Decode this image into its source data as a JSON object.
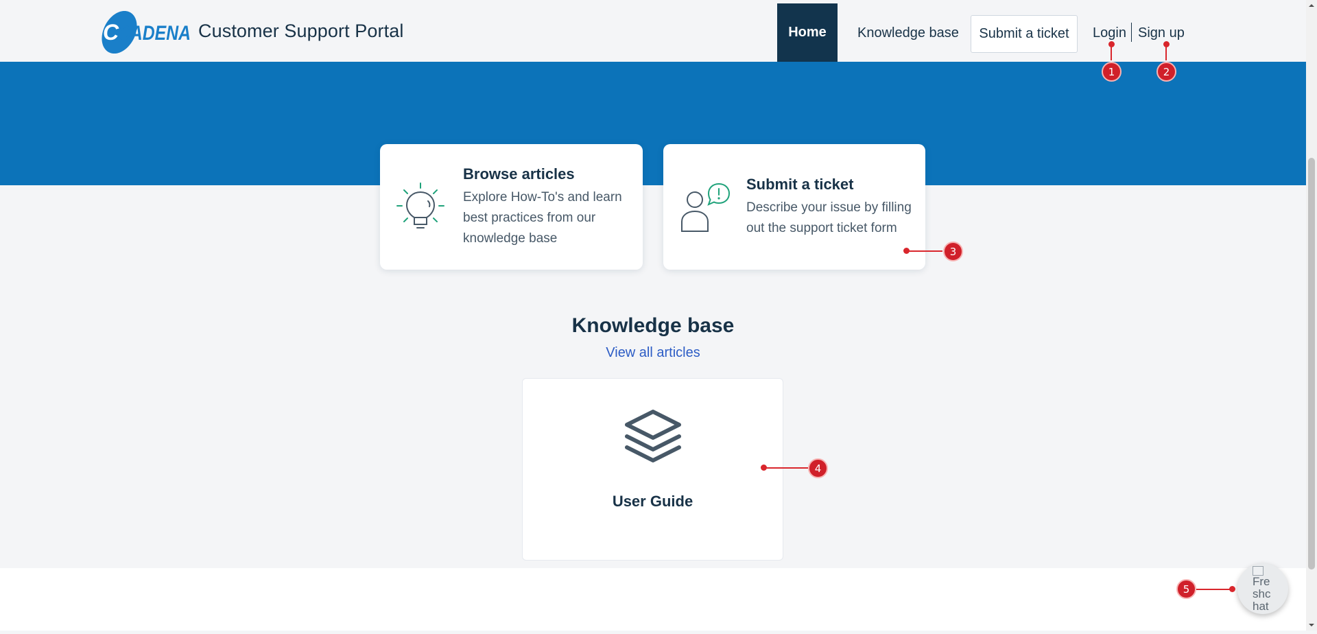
{
  "header": {
    "logo_text": "CADENA",
    "portal_title": "Customer Support Portal",
    "nav": {
      "home": "Home",
      "knowledge_base": "Knowledge base",
      "submit_ticket": "Submit a ticket",
      "login": "Login",
      "signup": "Sign up"
    }
  },
  "cards": {
    "browse": {
      "title": "Browse articles",
      "description": "Explore How-To's and learn best practices from our knowledge base",
      "icon": "lightbulb-icon"
    },
    "submit": {
      "title": "Submit a ticket",
      "description": "Describe your issue by filling out the support ticket form",
      "icon": "person-alert-icon"
    }
  },
  "knowledge_base": {
    "heading": "Knowledge base",
    "view_all": "View all articles",
    "categories": [
      {
        "title": "User Guide",
        "icon": "layers-icon"
      }
    ]
  },
  "chat": {
    "alt_text": "Freshchat logo"
  },
  "annotations": [
    "1",
    "2",
    "3",
    "4",
    "5"
  ],
  "colors": {
    "hero": "#0c73b9",
    "nav_active": "#12344d",
    "text_primary": "#183247",
    "link": "#2c5cc5",
    "icon_accent": "#1fa27a",
    "annotation": "#d9262c"
  }
}
